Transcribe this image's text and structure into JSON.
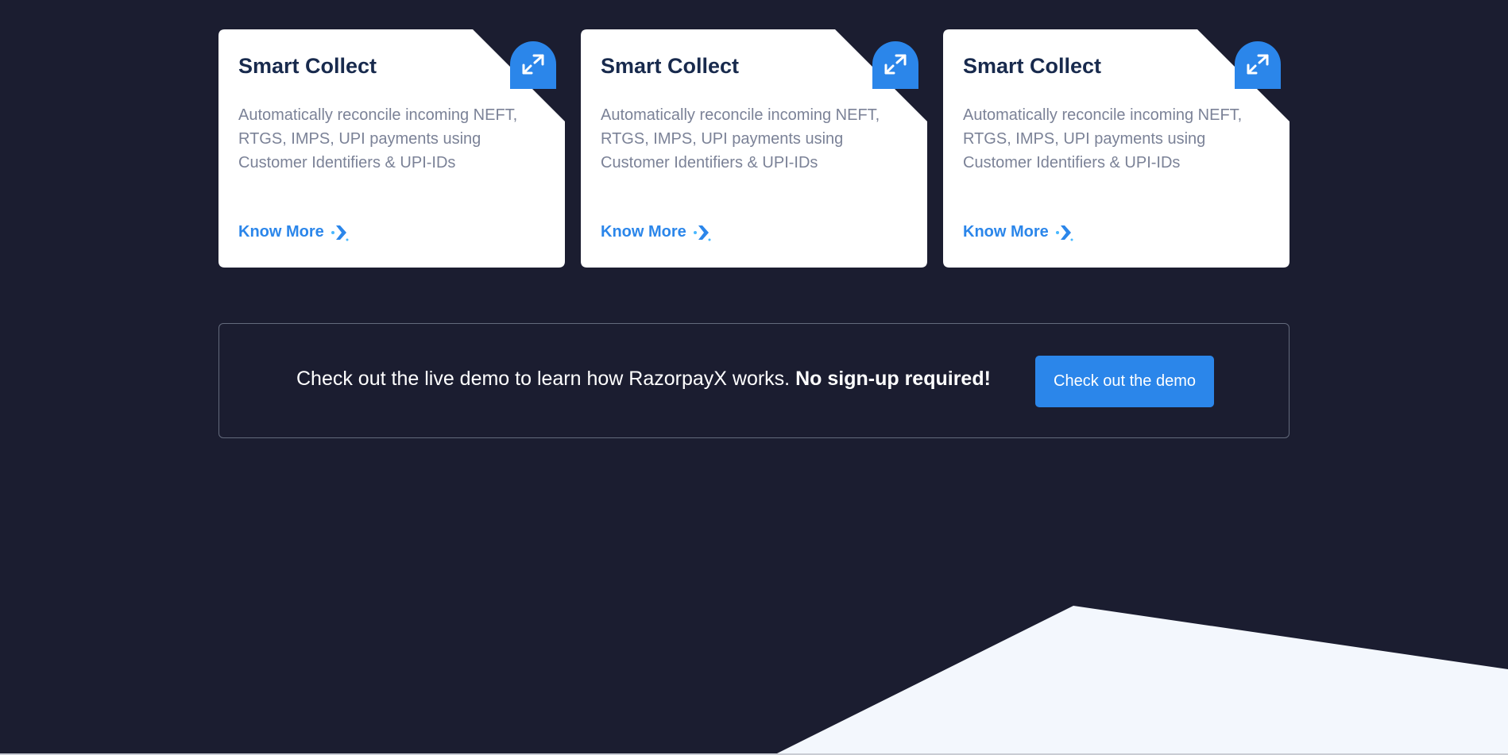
{
  "cards": [
    {
      "title": "Smart Collect",
      "description": "Automatically reconcile incoming NEFT, RTGS, IMPS, UPI payments using Customer Identifiers & UPI-IDs",
      "link_label": "Know More",
      "icon": "swap-arrows-icon"
    },
    {
      "title": "Smart Collect",
      "description": "Automatically reconcile incoming NEFT, RTGS, IMPS, UPI payments using Customer Identifiers & UPI-IDs",
      "link_label": "Know More",
      "icon": "swap-arrows-icon"
    },
    {
      "title": "Smart Collect",
      "description": "Automatically reconcile incoming NEFT, RTGS, IMPS, UPI payments using Customer Identifiers & UPI-IDs",
      "link_label": "Know More",
      "icon": "swap-arrows-icon"
    }
  ],
  "demo": {
    "text": "Check out the live demo to learn how RazorpayX works.",
    "emphasis": "No sign-up required!",
    "button_label": "Check out the demo"
  },
  "colors": {
    "background": "#1b1d30",
    "card": "#ffffff",
    "accent": "#2b86ea",
    "title": "#182a4d",
    "description": "#7b8297",
    "bottom_shape": "#f3f7fd"
  }
}
